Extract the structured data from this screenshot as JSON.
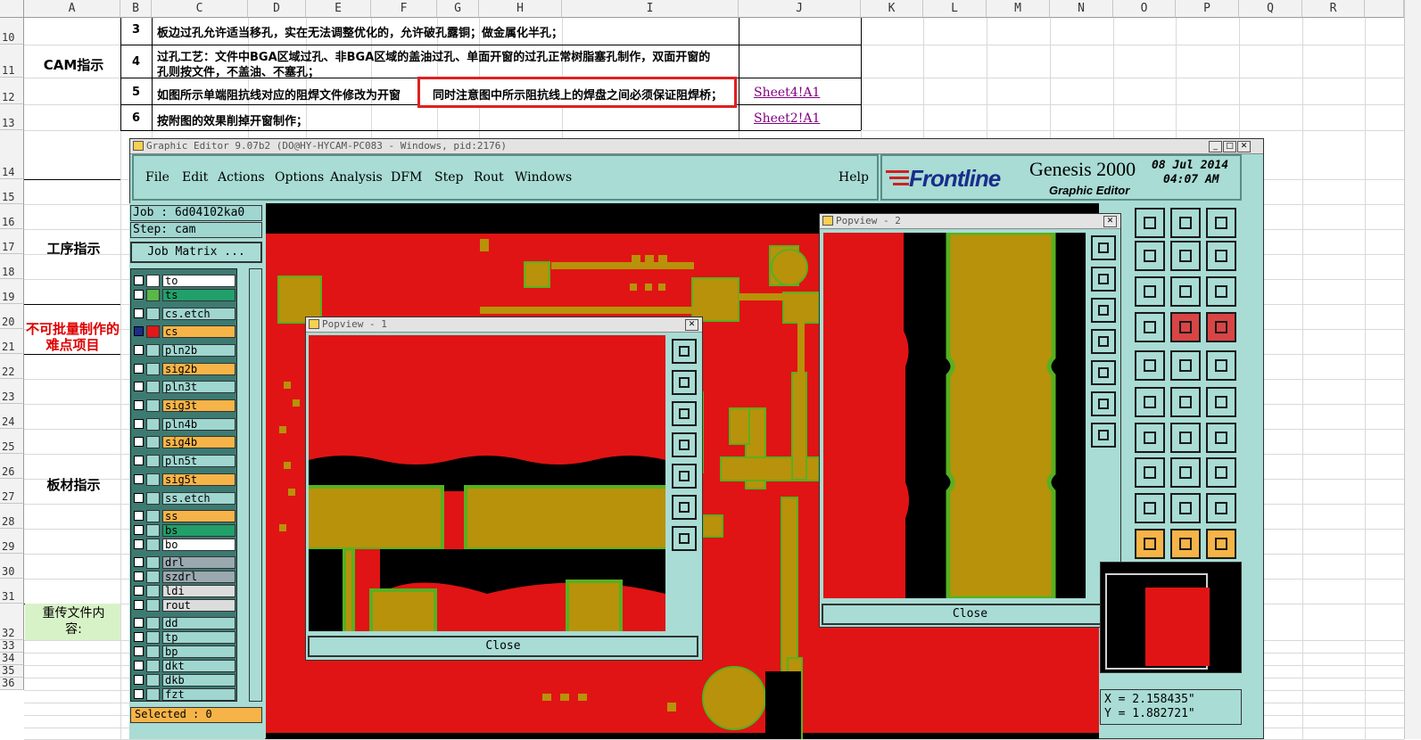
{
  "excel": {
    "columns": [
      "A",
      "B",
      "C",
      "D",
      "E",
      "F",
      "G",
      "H",
      "I",
      "J",
      "K",
      "L",
      "M",
      "N",
      "O",
      "P",
      "Q",
      "R"
    ],
    "rows": [
      "10",
      "11",
      "12",
      "13",
      "14",
      "15",
      "16",
      "17",
      "18",
      "19",
      "20",
      "21",
      "22",
      "23",
      "24",
      "25",
      "26",
      "27",
      "28",
      "29",
      "30",
      "31",
      "32",
      "33",
      "34",
      "35",
      "36"
    ],
    "section_labels": {
      "cam": "CAM指示",
      "process": "工序指示",
      "difficult": "不可批量制作的难点项目",
      "board": "板材指示",
      "reupload": "重传文件内容:"
    },
    "items": [
      {
        "no": "3",
        "text": "板边过孔允许适当移孔，实在无法调整优化的，允许破孔露铜；做金属化半孔；"
      },
      {
        "no": "4",
        "text_line1": "过孔工艺：文件中BGA区域过孔、非BGA区域的盖油过孔、单面开窗的过孔正常树脂塞孔制作，双面开窗的",
        "text_line2": "孔则按文件，不盖油、不塞孔；"
      },
      {
        "no": "5",
        "text": "如图所示单端阻抗线对应的阻焊文件修改为开窗",
        "callout": "同时注意图中所示阻抗线上的焊盘之间必须保证阻焊桥；",
        "link": "Sheet4!A1"
      },
      {
        "no": "6",
        "text": "按附图的效果削掉开窗制作；",
        "link": "Sheet2!A1"
      }
    ]
  },
  "genesis": {
    "window_title": "Graphic Editor 9.07b2 (DO@HY-HYCAM-PC083 - Windows, pid:2176)",
    "menu": [
      "File",
      "Edit",
      "Actions",
      "Options",
      "Analysis",
      "DFM",
      "Step",
      "Rout",
      "Windows"
    ],
    "help": "Help",
    "brand": "Frontline",
    "product": "Genesis 2000",
    "subtitle": "Graphic Editor",
    "date": "08 Jul 2014",
    "time": "04:07 AM",
    "job": "Job : 6d04102ka0",
    "step": "Step: cam",
    "job_matrix": "Job Matrix ...",
    "layers": [
      {
        "name": "to",
        "color": "#ffffff",
        "sw": "#ffffff"
      },
      {
        "name": "ts",
        "color": "#22a06a",
        "sw": "#58b848"
      },
      {
        "name": "cs.etch",
        "color": "#9fd6d0",
        "sw": "#9fd6d0"
      },
      {
        "name": "cs",
        "color": "#f6b448",
        "sw": "#e01818"
      },
      {
        "name": "pln2b",
        "color": "#9fd6d0",
        "sw": "#9fd6d0"
      },
      {
        "name": "sig2b",
        "color": "#f6b448",
        "sw": "#9fd6d0"
      },
      {
        "name": "pln3t",
        "color": "#9fd6d0",
        "sw": "#9fd6d0"
      },
      {
        "name": "sig3t",
        "color": "#f6b448",
        "sw": "#9fd6d0"
      },
      {
        "name": "pln4b",
        "color": "#9fd6d0",
        "sw": "#9fd6d0"
      },
      {
        "name": "sig4b",
        "color": "#f6b448",
        "sw": "#9fd6d0"
      },
      {
        "name": "pln5t",
        "color": "#9fd6d0",
        "sw": "#9fd6d0"
      },
      {
        "name": "sig5t",
        "color": "#f6b448",
        "sw": "#9fd6d0"
      },
      {
        "name": "ss.etch",
        "color": "#9fd6d0",
        "sw": "#9fd6d0"
      },
      {
        "name": "ss",
        "color": "#f6b448",
        "sw": "#9fd6d0"
      },
      {
        "name": "bs",
        "color": "#22a06a",
        "sw": "#9fd6d0"
      },
      {
        "name": "bo",
        "color": "#ffffff",
        "sw": "#9fd6d0"
      },
      {
        "name": "drl",
        "color": "#9aa8b0",
        "sw": "#9fd6d0"
      },
      {
        "name": "szdrl",
        "color": "#9aa8b0",
        "sw": "#9fd6d0"
      },
      {
        "name": "ldi",
        "color": "#dcdcdc",
        "sw": "#9fd6d0"
      },
      {
        "name": "rout",
        "color": "#dcdcdc",
        "sw": "#9fd6d0"
      },
      {
        "name": "dd",
        "color": "#9fd6d0",
        "sw": "#9fd6d0"
      },
      {
        "name": "tp",
        "color": "#9fd6d0",
        "sw": "#9fd6d0"
      },
      {
        "name": "bp",
        "color": "#9fd6d0",
        "sw": "#9fd6d0"
      },
      {
        "name": "dkt",
        "color": "#9fd6d0",
        "sw": "#9fd6d0"
      },
      {
        "name": "dkb",
        "color": "#9fd6d0",
        "sw": "#9fd6d0"
      },
      {
        "name": "fzt",
        "color": "#9fd6d0",
        "sw": "#9fd6d0"
      }
    ],
    "selected": "Selected : 0",
    "coord_x": "X = 2.158435\"",
    "coord_y": "Y = 1.882721\"",
    "popview1_title": "Popview - 1",
    "popview2_title": "Popview - 2",
    "close_label": "Close",
    "tool_icons": [
      "open-icon",
      "save-icon",
      "home-icon",
      "grid-icon",
      "back-icon",
      "forward-icon",
      "undo-icon",
      "snap-icon",
      "pan-icon",
      "zoom-center-icon",
      "ratio-icon",
      "help-icon",
      "grid2-icon",
      "net-icon",
      "net2-icon",
      "vertex-icon",
      "ruler-icon",
      "point-icon",
      "cross-icon",
      "line-icon",
      "line2-icon",
      "line3-icon",
      "arc-icon",
      "freeline-icon",
      "measure-icon",
      "width-icon",
      "width2-icon",
      "arrow-icon",
      "arrow2-icon",
      "arrow3-icon",
      "select-icon",
      "select2-icon",
      "select3-icon"
    ]
  }
}
